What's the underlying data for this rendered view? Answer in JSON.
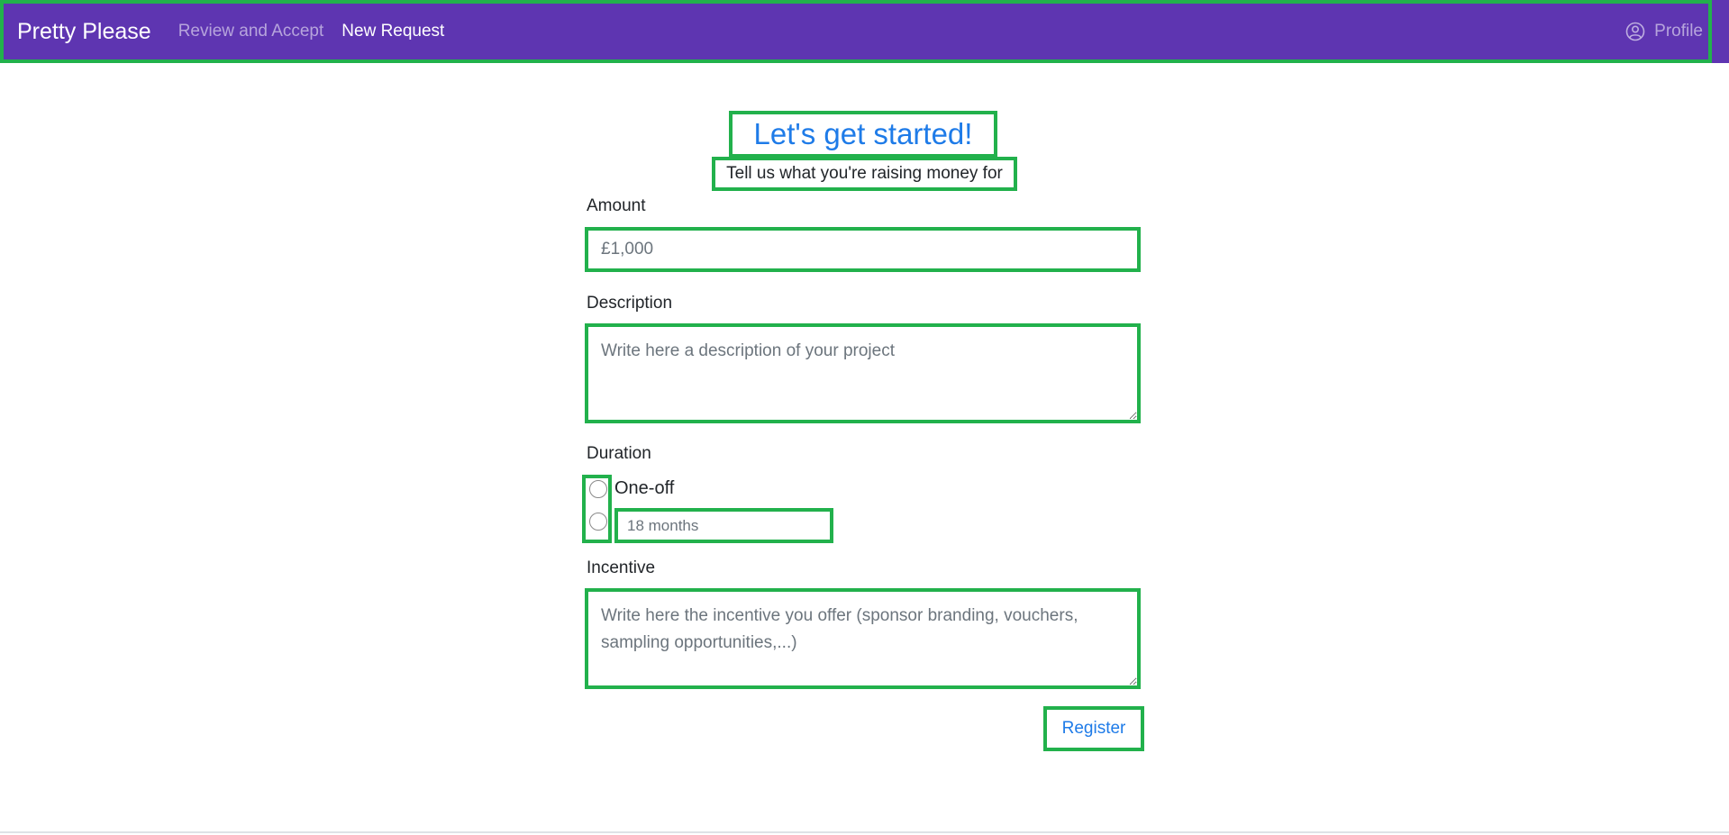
{
  "navbar": {
    "brand": "Pretty Please",
    "links": [
      {
        "label": "Review and Accept",
        "active": false
      },
      {
        "label": "New Request",
        "active": true
      }
    ],
    "profile_label": "Profile",
    "background_color": "#5e35b1"
  },
  "hero": {
    "title": "Let's get started!",
    "subtitle": "Tell us what you're raising money for"
  },
  "form": {
    "amount": {
      "label": "Amount",
      "placeholder": "£1,000",
      "value": ""
    },
    "description": {
      "label": "Description",
      "placeholder": "Write here a description of your project",
      "value": ""
    },
    "duration": {
      "label": "Duration",
      "options": [
        {
          "label": "One-off",
          "selected": false
        },
        {
          "label": "",
          "selected": false,
          "input_placeholder": "18 months"
        }
      ]
    },
    "incentive": {
      "label": "Incentive",
      "placeholder": "Write here the incentive you offer (sponsor branding, vouchers, sampling opportunities,...)",
      "value": ""
    },
    "submit_label": "Register"
  },
  "colors": {
    "accent_blue": "#1e7be8",
    "highlight_green": "#22b14c"
  }
}
